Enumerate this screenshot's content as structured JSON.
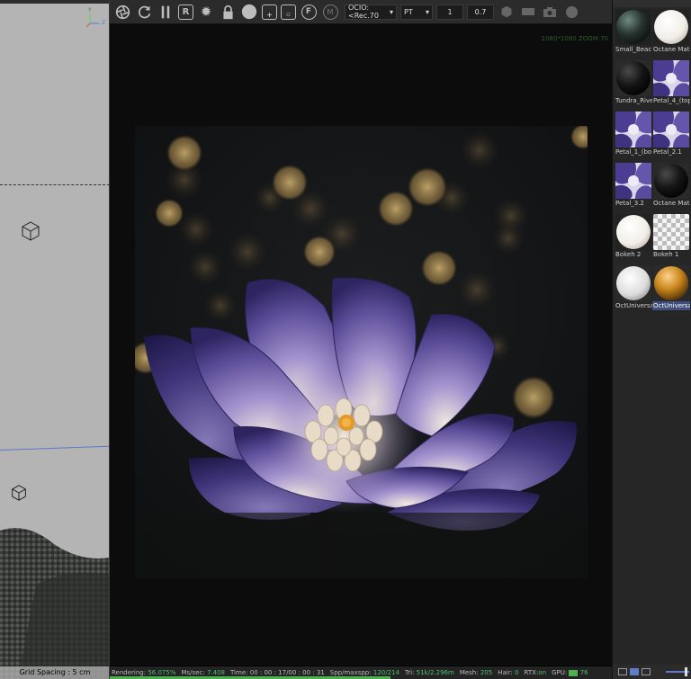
{
  "viewport": {
    "grid_spacing": "Grid Spacing : 5 cm",
    "axis_labels": {
      "y": "Y",
      "z": "Z"
    }
  },
  "toolbar": {
    "icons": [
      "aperture-icon",
      "refresh-icon",
      "pause-icon",
      "region-icon",
      "gear-icon",
      "lock-icon",
      "sphere-icon",
      "add-icon",
      "camera-add-icon",
      "f-icon",
      "m-icon"
    ],
    "region_letter": "R",
    "f_letter": "F",
    "m_letter": "M",
    "ocio_select": "OCIO:<Rec.70",
    "kernel_select": "PT",
    "value_1": "1",
    "value_2": "0.7"
  },
  "render": {
    "resolution_label": "1080*1080 ZOOM:70",
    "image_description_colors": {
      "petal": "#5d4f9a",
      "background": "#111315",
      "bokeh": "#c9a661"
    }
  },
  "status": {
    "rendering_label": "Rendering:",
    "rendering_value": "56.075%",
    "mssec_label": "Ms/sec:",
    "mssec_value": "7.408",
    "time_label": "Time:",
    "time_value": "00 : 00 : 17/00 : 00 : 31",
    "spp_label": "Spp/maxspp:",
    "spp_value": "120/214",
    "tri_label": "Tri:",
    "tri_value": "51k/2.296m",
    "mesh_label": "Mesh:",
    "mesh_value": "205",
    "hair_label": "Hair:",
    "hair_value": "0",
    "rtx_label": "RTX:",
    "rtx_value": "on",
    "gpu_label": "GPU:",
    "gpu_value": "76",
    "progress": 0.56
  },
  "materials": [
    {
      "name": "Small_Beac",
      "kind": "dark-green"
    },
    {
      "name": "Octane Mat",
      "kind": "white"
    },
    {
      "name": "Tundra_Rive",
      "kind": "black"
    },
    {
      "name": "Petal_4_(top",
      "kind": "purple"
    },
    {
      "name": "Petal_1_(bo",
      "kind": "purple"
    },
    {
      "name": "Petal_2.1",
      "kind": "purple"
    },
    {
      "name": "Petal_3.2",
      "kind": "purple"
    },
    {
      "name": "Octane Mat",
      "kind": "black"
    },
    {
      "name": "Bokeh 2",
      "kind": "white"
    },
    {
      "name": "Bokeh 1",
      "kind": "checker"
    },
    {
      "name": "OctUniversa",
      "kind": "light"
    },
    {
      "name": "OctUniversa",
      "kind": "orange"
    }
  ],
  "selected_material_index": 11
}
